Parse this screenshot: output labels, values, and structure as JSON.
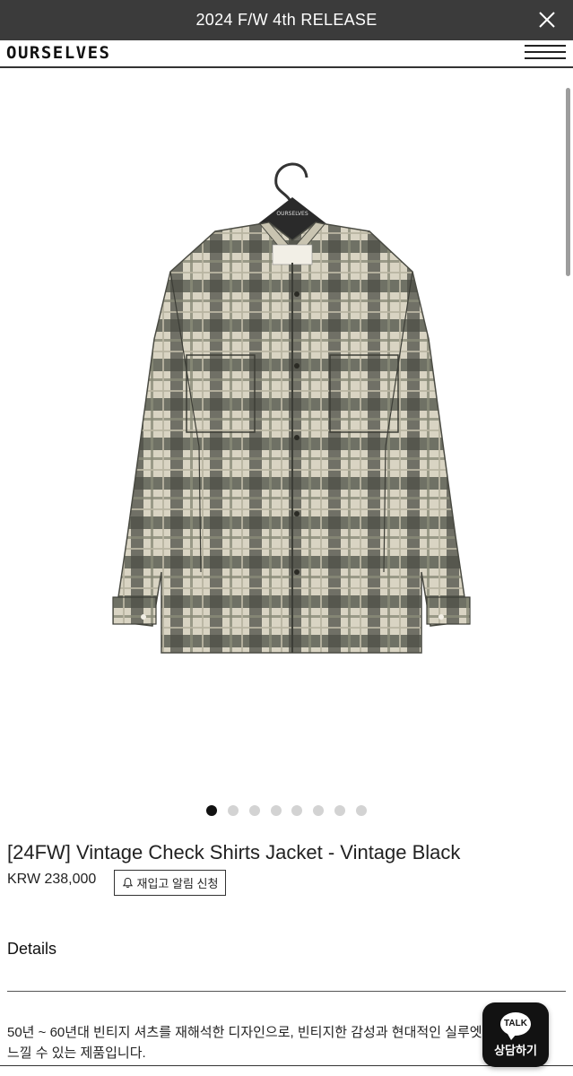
{
  "promo": {
    "text": "2024 F/W 4th RELEASE",
    "close_icon": "close-icon"
  },
  "header": {
    "logo": "OURSELVES",
    "menu_icon": "hamburger-menu-icon"
  },
  "gallery": {
    "image_count": 8,
    "active_index": 0,
    "hanger_label": "OURSELVES"
  },
  "product": {
    "title": "[24FW] Vintage Check Shirts Jacket - Vintage Black",
    "price": "KRW 238,000",
    "restock_label": "재입고 알림 신청",
    "bell_icon": "bell-icon"
  },
  "details": {
    "label": "Details",
    "description": "50년 ~ 60년대 빈티지 셔츠를 재해석한 디자인으로, 빈티지한 감성과 현대적인 실루엣을 동시에 느낄 수 있는 제품입니다."
  },
  "kakao": {
    "bubble": "TALK",
    "label": "상담하기"
  },
  "colors": {
    "promo_bg": "#3b3b3b",
    "kakao_bg": "#121212",
    "dot_active": "#111111",
    "dot_inactive": "#d3d3d3"
  }
}
